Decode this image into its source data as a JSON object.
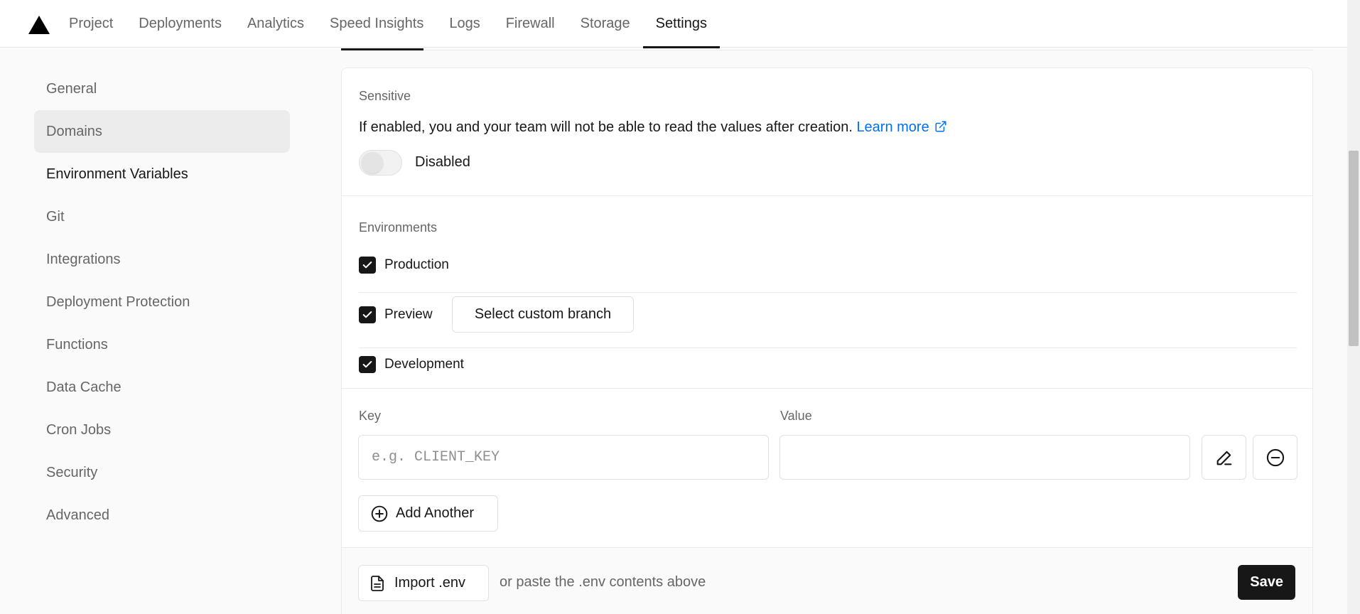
{
  "topnav": {
    "tabs": [
      {
        "label": "Project",
        "active": false
      },
      {
        "label": "Deployments",
        "active": false
      },
      {
        "label": "Analytics",
        "active": false
      },
      {
        "label": "Speed Insights",
        "active": false
      },
      {
        "label": "Logs",
        "active": false
      },
      {
        "label": "Firewall",
        "active": false
      },
      {
        "label": "Storage",
        "active": false
      },
      {
        "label": "Settings",
        "active": true
      }
    ]
  },
  "sidebar": {
    "items": [
      {
        "label": "General"
      },
      {
        "label": "Domains"
      },
      {
        "label": "Environment Variables"
      },
      {
        "label": "Git"
      },
      {
        "label": "Integrations"
      },
      {
        "label": "Deployment Protection"
      },
      {
        "label": "Functions"
      },
      {
        "label": "Data Cache"
      },
      {
        "label": "Cron Jobs"
      },
      {
        "label": "Security"
      },
      {
        "label": "Advanced"
      }
    ],
    "active": "Environment Variables",
    "hovered": "Domains"
  },
  "sensitive": {
    "title": "Sensitive",
    "description": "If enabled, you and your team will not be able to read the values after creation.",
    "learn_more": "Learn more",
    "toggle_label": "Disabled",
    "enabled": false
  },
  "environments": {
    "title": "Environments",
    "production": {
      "label": "Production",
      "checked": true
    },
    "preview": {
      "label": "Preview",
      "checked": true,
      "branch_button": "Select custom branch"
    },
    "development": {
      "label": "Development",
      "checked": true
    }
  },
  "keyvalue": {
    "key_label": "Key",
    "value_label": "Value",
    "key_placeholder": "e.g. CLIENT_KEY",
    "key_value": "",
    "value_value": "",
    "add_another": "Add Another"
  },
  "footer": {
    "import_button": "Import .env",
    "hint": "or paste the .env contents above",
    "save_button": "Save"
  },
  "colors": {
    "link": "#0070f3",
    "primary": "#171717"
  }
}
